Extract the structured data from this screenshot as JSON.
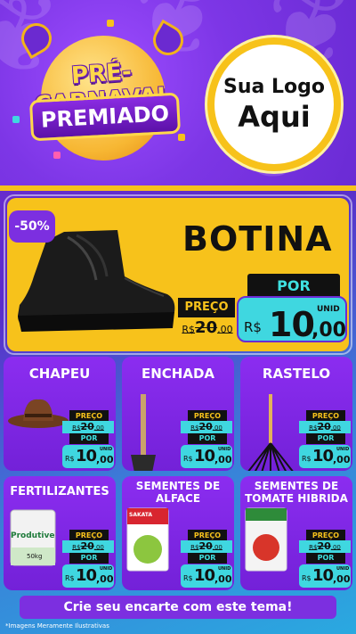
{
  "header": {
    "badge_top": "PRÉ-CARNAVAL",
    "badge_bottom": "PREMIADO",
    "logo_line1": "Sua Logo",
    "logo_line2": "Aqui"
  },
  "hero": {
    "discount": "-50%",
    "title": "BOTINA",
    "preco_label": "PREÇO",
    "old_currency": "R$",
    "old_int": "20",
    "old_dec": ",00",
    "por_label": "POR",
    "currency": "R$",
    "price_int": "10",
    "price_dec": ",00",
    "unit": "UNID"
  },
  "products": [
    {
      "title": "CHAPEU",
      "preco_label": "PREÇO",
      "old_currency": "R$",
      "old_int": "20",
      "old_dec": ",00",
      "por_label": "POR",
      "currency": "R$",
      "price_int": "10",
      "price_dec": ",00",
      "unit": "UNID"
    },
    {
      "title": "ENCHADA",
      "preco_label": "PREÇO",
      "old_currency": "R$",
      "old_int": "20",
      "old_dec": ",00",
      "por_label": "POR",
      "currency": "R$",
      "price_int": "10",
      "price_dec": ",00",
      "unit": "UNID"
    },
    {
      "title": "RASTELO",
      "preco_label": "PREÇO",
      "old_currency": "R$",
      "old_int": "20",
      "old_dec": ",00",
      "por_label": "POR",
      "currency": "R$",
      "price_int": "10",
      "price_dec": ",00",
      "unit": "UNID"
    },
    {
      "title": "FERTILIZANTES",
      "preco_label": "PREÇO",
      "old_currency": "R$",
      "old_int": "20",
      "old_dec": ",00",
      "por_label": "POR",
      "currency": "R$",
      "price_int": "10",
      "price_dec": ",00",
      "unit": "UNID",
      "pack_brand": "Produtive",
      "pack_weight": "50kg"
    },
    {
      "title": "SEMENTES DE ALFACE",
      "preco_label": "PREÇO",
      "old_currency": "R$",
      "old_int": "20",
      "old_dec": ",00",
      "por_label": "POR",
      "currency": "R$",
      "price_int": "10",
      "price_dec": ",00",
      "unit": "UNID",
      "pack_brand": "SAKATA"
    },
    {
      "title": "SEMENTES DE TOMATE HIBRIDA",
      "preco_label": "PREÇO",
      "old_currency": "R$",
      "old_int": "20",
      "old_dec": ",00",
      "por_label": "POR",
      "currency": "R$",
      "price_int": "10",
      "price_dec": ",00",
      "unit": "UNID"
    }
  ],
  "footer": {
    "cta": "Crie seu encarte com este tema!",
    "disclaimer": "*Imagens Meramente Ilustrativas"
  },
  "colors": {
    "purple": "#7c2fe0",
    "yellow": "#f7c21b",
    "cyan": "#3fd7e0",
    "black": "#111111"
  }
}
